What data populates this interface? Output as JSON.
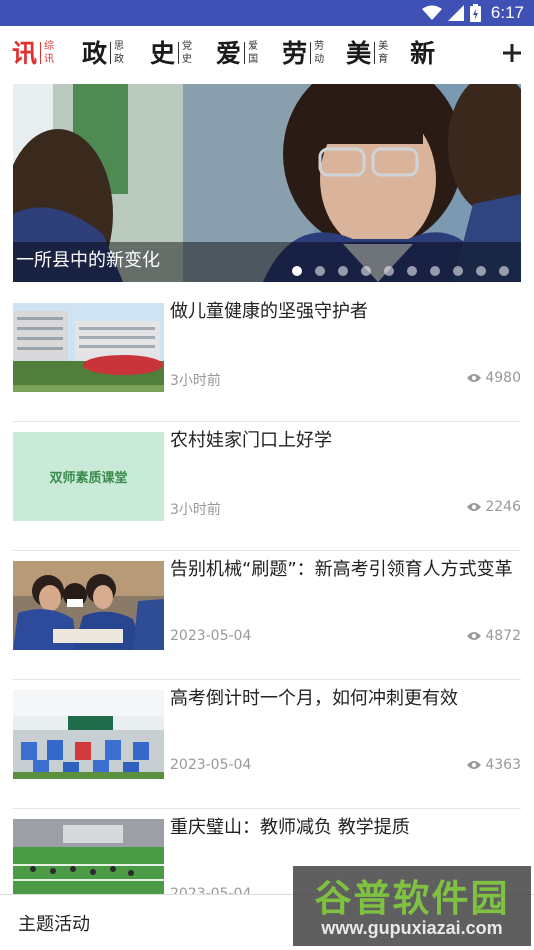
{
  "status_bar": {
    "time": "6:17"
  },
  "tabs": [
    {
      "main": "讯",
      "sub": "综讯",
      "active": true
    },
    {
      "main": "政",
      "sub": "思政"
    },
    {
      "main": "史",
      "sub": "党史"
    },
    {
      "main": "爱",
      "sub": "爱国"
    },
    {
      "main": "劳",
      "sub": "劳动"
    },
    {
      "main": "美",
      "sub": "美育"
    },
    {
      "main": "新",
      "sub": ""
    }
  ],
  "add_button": "+",
  "banner": {
    "caption": "一所县中的新变化",
    "page_count": 10,
    "active_index": 0
  },
  "news": [
    {
      "title": "做儿童健康的坚强守护者",
      "time": "3小时前",
      "views": "4980",
      "thumb": "hospital-buildings"
    },
    {
      "title": "农村娃家门口上好学",
      "time": "3小时前",
      "views": "2246",
      "thumb_text": "双师素质课堂"
    },
    {
      "title": "告别机械“刷题”：新高考引领育人方式变革",
      "time": "2023-05-04",
      "views": "4872",
      "thumb": "students-studying"
    },
    {
      "title": "高考倒计时一个月，如何冲刺更有效",
      "time": "2023-05-04",
      "views": "4363",
      "thumb": "classroom"
    },
    {
      "title": "重庆璧山：教师减负 教学提质",
      "time": "2023-05-04",
      "views": "",
      "thumb": "sports-field"
    }
  ],
  "bottom_bar": {
    "label": "主题活动"
  },
  "watermark": {
    "name": "谷普软件园",
    "url": "www.gupuxiazai.com"
  },
  "colors": {
    "status_bar": "#3f51b5",
    "active_tab": "#e03030",
    "meta_text": "#999999"
  }
}
